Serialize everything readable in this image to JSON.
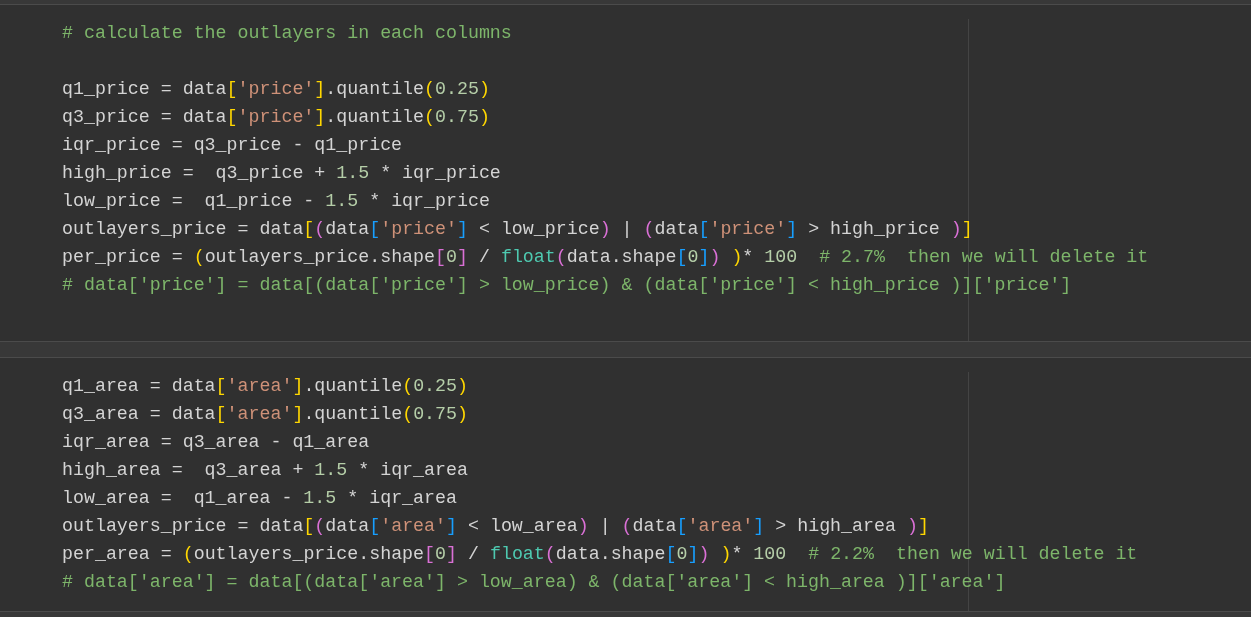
{
  "cells": [
    {
      "lines": [
        {
          "kind": "code",
          "tokens": [
            {
              "kind": "comment",
              "text": "# calculate the outlayers in each columns"
            }
          ]
        },
        {
          "kind": "blank"
        },
        {
          "kind": "code",
          "tokens": [
            {
              "kind": "plain",
              "text": "q1_price = data"
            },
            {
              "kind": "bracket1",
              "text": "["
            },
            {
              "kind": "string",
              "text": "'price'"
            },
            {
              "kind": "bracket1",
              "text": "]"
            },
            {
              "kind": "plain",
              "text": ".quantile"
            },
            {
              "kind": "bracket1",
              "text": "("
            },
            {
              "kind": "number",
              "text": "0.25"
            },
            {
              "kind": "bracket1",
              "text": ")"
            }
          ]
        },
        {
          "kind": "code",
          "tokens": [
            {
              "kind": "plain",
              "text": "q3_price = data"
            },
            {
              "kind": "bracket1",
              "text": "["
            },
            {
              "kind": "string",
              "text": "'price'"
            },
            {
              "kind": "bracket1",
              "text": "]"
            },
            {
              "kind": "plain",
              "text": ".quantile"
            },
            {
              "kind": "bracket1",
              "text": "("
            },
            {
              "kind": "number",
              "text": "0.75"
            },
            {
              "kind": "bracket1",
              "text": ")"
            }
          ]
        },
        {
          "kind": "code",
          "tokens": [
            {
              "kind": "plain",
              "text": "iqr_price = q3_price - q1_price"
            }
          ]
        },
        {
          "kind": "code",
          "tokens": [
            {
              "kind": "plain",
              "text": "high_price =  q3_price + "
            },
            {
              "kind": "number",
              "text": "1.5"
            },
            {
              "kind": "plain",
              "text": " * iqr_price"
            }
          ]
        },
        {
          "kind": "code",
          "tokens": [
            {
              "kind": "plain",
              "text": "low_price =  q1_price - "
            },
            {
              "kind": "number",
              "text": "1.5"
            },
            {
              "kind": "plain",
              "text": " * iqr_price"
            }
          ]
        },
        {
          "kind": "code",
          "tokens": [
            {
              "kind": "plain",
              "text": "outlayers_price = data"
            },
            {
              "kind": "bracket1",
              "text": "["
            },
            {
              "kind": "bracket2",
              "text": "("
            },
            {
              "kind": "plain",
              "text": "data"
            },
            {
              "kind": "bracket3",
              "text": "["
            },
            {
              "kind": "string",
              "text": "'price'"
            },
            {
              "kind": "bracket3",
              "text": "]"
            },
            {
              "kind": "plain",
              "text": " < low_price"
            },
            {
              "kind": "bracket2",
              "text": ")"
            },
            {
              "kind": "plain",
              "text": " | "
            },
            {
              "kind": "bracket2",
              "text": "("
            },
            {
              "kind": "plain",
              "text": "data"
            },
            {
              "kind": "bracket3",
              "text": "["
            },
            {
              "kind": "string",
              "text": "'price'"
            },
            {
              "kind": "bracket3",
              "text": "]"
            },
            {
              "kind": "plain",
              "text": " > high_price "
            },
            {
              "kind": "bracket2",
              "text": ")"
            },
            {
              "kind": "bracket1",
              "text": "]"
            }
          ]
        },
        {
          "kind": "code",
          "tokens": [
            {
              "kind": "plain",
              "text": "per_price = "
            },
            {
              "kind": "bracket1",
              "text": "("
            },
            {
              "kind": "plain",
              "text": "outlayers_price.shape"
            },
            {
              "kind": "bracket2",
              "text": "["
            },
            {
              "kind": "number",
              "text": "0"
            },
            {
              "kind": "bracket2",
              "text": "]"
            },
            {
              "kind": "plain",
              "text": " / "
            },
            {
              "kind": "builtin",
              "text": "float"
            },
            {
              "kind": "bracket2",
              "text": "("
            },
            {
              "kind": "plain",
              "text": "data.shape"
            },
            {
              "kind": "bracket3",
              "text": "["
            },
            {
              "kind": "number",
              "text": "0"
            },
            {
              "kind": "bracket3",
              "text": "]"
            },
            {
              "kind": "bracket2",
              "text": ")"
            },
            {
              "kind": "bracket1",
              "text": " )"
            },
            {
              "kind": "plain",
              "text": "* "
            },
            {
              "kind": "number",
              "text": "100"
            },
            {
              "kind": "comment",
              "text": "  # 2.7%  then we will delete it"
            }
          ]
        },
        {
          "kind": "code",
          "tokens": [
            {
              "kind": "comment",
              "text": "# data['price'] = data[(data['price'] > low_price) & (data['price'] < high_price )]['price']"
            }
          ]
        }
      ]
    },
    {
      "lines": [
        {
          "kind": "code",
          "tokens": [
            {
              "kind": "plain",
              "text": "q1_area = data"
            },
            {
              "kind": "bracket1",
              "text": "["
            },
            {
              "kind": "string",
              "text": "'area'"
            },
            {
              "kind": "bracket1",
              "text": "]"
            },
            {
              "kind": "plain",
              "text": ".quantile"
            },
            {
              "kind": "bracket1",
              "text": "("
            },
            {
              "kind": "number",
              "text": "0.25"
            },
            {
              "kind": "bracket1",
              "text": ")"
            }
          ]
        },
        {
          "kind": "code",
          "tokens": [
            {
              "kind": "plain",
              "text": "q3_area = data"
            },
            {
              "kind": "bracket1",
              "text": "["
            },
            {
              "kind": "string",
              "text": "'area'"
            },
            {
              "kind": "bracket1",
              "text": "]"
            },
            {
              "kind": "plain",
              "text": ".quantile"
            },
            {
              "kind": "bracket1",
              "text": "("
            },
            {
              "kind": "number",
              "text": "0.75"
            },
            {
              "kind": "bracket1",
              "text": ")"
            }
          ]
        },
        {
          "kind": "code",
          "tokens": [
            {
              "kind": "plain",
              "text": "iqr_area = q3_area - q1_area"
            }
          ]
        },
        {
          "kind": "code",
          "tokens": [
            {
              "kind": "plain",
              "text": "high_area =  q3_area + "
            },
            {
              "kind": "number",
              "text": "1.5"
            },
            {
              "kind": "plain",
              "text": " * iqr_area"
            }
          ]
        },
        {
          "kind": "code",
          "tokens": [
            {
              "kind": "plain",
              "text": "low_area =  q1_area - "
            },
            {
              "kind": "number",
              "text": "1.5"
            },
            {
              "kind": "plain",
              "text": " * iqr_area"
            }
          ]
        },
        {
          "kind": "code",
          "tokens": [
            {
              "kind": "plain",
              "text": "outlayers_price = data"
            },
            {
              "kind": "bracket1",
              "text": "["
            },
            {
              "kind": "bracket2",
              "text": "("
            },
            {
              "kind": "plain",
              "text": "data"
            },
            {
              "kind": "bracket3",
              "text": "["
            },
            {
              "kind": "string",
              "text": "'area'"
            },
            {
              "kind": "bracket3",
              "text": "]"
            },
            {
              "kind": "plain",
              "text": " < low_area"
            },
            {
              "kind": "bracket2",
              "text": ")"
            },
            {
              "kind": "plain",
              "text": " | "
            },
            {
              "kind": "bracket2",
              "text": "("
            },
            {
              "kind": "plain",
              "text": "data"
            },
            {
              "kind": "bracket3",
              "text": "["
            },
            {
              "kind": "string",
              "text": "'area'"
            },
            {
              "kind": "bracket3",
              "text": "]"
            },
            {
              "kind": "plain",
              "text": " > high_area "
            },
            {
              "kind": "bracket2",
              "text": ")"
            },
            {
              "kind": "bracket1",
              "text": "]"
            }
          ]
        },
        {
          "kind": "code",
          "tokens": [
            {
              "kind": "plain",
              "text": "per_area = "
            },
            {
              "kind": "bracket1",
              "text": "("
            },
            {
              "kind": "plain",
              "text": "outlayers_price.shape"
            },
            {
              "kind": "bracket2",
              "text": "["
            },
            {
              "kind": "number",
              "text": "0"
            },
            {
              "kind": "bracket2",
              "text": "]"
            },
            {
              "kind": "plain",
              "text": " / "
            },
            {
              "kind": "builtin",
              "text": "float"
            },
            {
              "kind": "bracket2",
              "text": "("
            },
            {
              "kind": "plain",
              "text": "data.shape"
            },
            {
              "kind": "bracket3",
              "text": "["
            },
            {
              "kind": "number",
              "text": "0"
            },
            {
              "kind": "bracket3",
              "text": "]"
            },
            {
              "kind": "bracket2",
              "text": ")"
            },
            {
              "kind": "bracket1",
              "text": " )"
            },
            {
              "kind": "plain",
              "text": "* "
            },
            {
              "kind": "number",
              "text": "100"
            },
            {
              "kind": "comment",
              "text": "  # 2.2%  then we will delete it"
            }
          ]
        },
        {
          "kind": "code",
          "tokens": [
            {
              "kind": "comment",
              "text": "# data['area'] = data[(data['area'] > low_area) & (data['area'] < high_area )]['area']"
            }
          ]
        }
      ]
    }
  ]
}
